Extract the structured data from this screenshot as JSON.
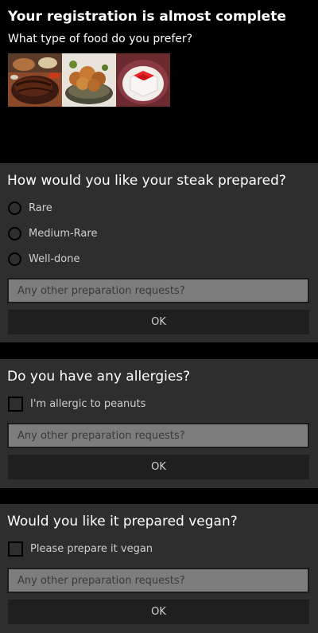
{
  "header": {
    "title": "Your registration is almost complete",
    "question": "What type of food do you prefer?",
    "food_images": [
      "steak-image",
      "fried-chicken-image",
      "vegan-dessert-image"
    ]
  },
  "steak_panel": {
    "question": "How would you like your steak prepared?",
    "options": [
      "Rare",
      "Medium-Rare",
      "Well-done"
    ],
    "input_placeholder": "Any other preparation requests?",
    "ok_label": "OK"
  },
  "allergy_panel": {
    "question": "Do you have any allergies?",
    "checkbox_label": "I'm allergic to peanuts",
    "input_placeholder": "Any other preparation requests?",
    "ok_label": "OK"
  },
  "vegan_panel": {
    "question": "Would you like it prepared vegan?",
    "checkbox_label": "Please prepare it vegan",
    "input_placeholder": "Any other preparation requests?",
    "ok_label": "OK"
  },
  "colors": {
    "background": "#000000",
    "panel": "#2e2e2e",
    "input": "#7d7d7d",
    "button": "#1f1f1f",
    "text": "#ffffff",
    "option_text": "#cfcfcf"
  }
}
